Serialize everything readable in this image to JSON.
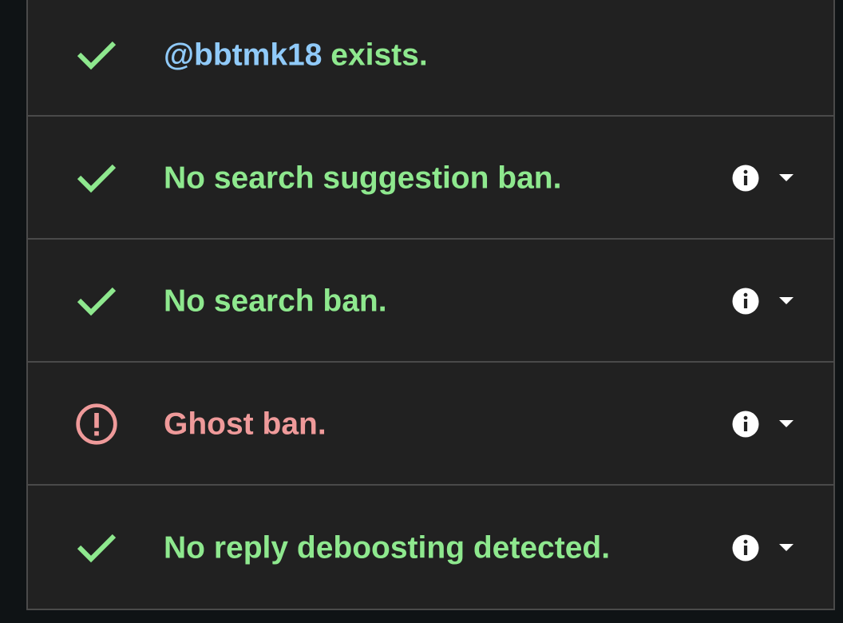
{
  "results": {
    "items": [
      {
        "status": "ok",
        "icon": "check-icon",
        "handle": "@bbtmk18",
        "text": " exists.",
        "has_details": false
      },
      {
        "status": "ok",
        "icon": "check-icon",
        "text": "No search suggestion ban.",
        "has_details": true
      },
      {
        "status": "ok",
        "icon": "check-icon",
        "text": "No search ban.",
        "has_details": true
      },
      {
        "status": "warning",
        "icon": "alert-circle-icon",
        "text": "Ghost ban.",
        "has_details": true
      },
      {
        "status": "ok",
        "icon": "check-icon",
        "text": "No reply deboosting detected.",
        "has_details": true
      }
    ]
  },
  "colors": {
    "ok": "#8ee88e",
    "warning": "#ef9a9a",
    "handle": "#90caf9",
    "panel_bg": "#212121",
    "page_bg": "#0f1315",
    "divider": "#4a4a4a"
  },
  "icons": {
    "info": "info-icon",
    "expand": "caret-down-icon"
  }
}
